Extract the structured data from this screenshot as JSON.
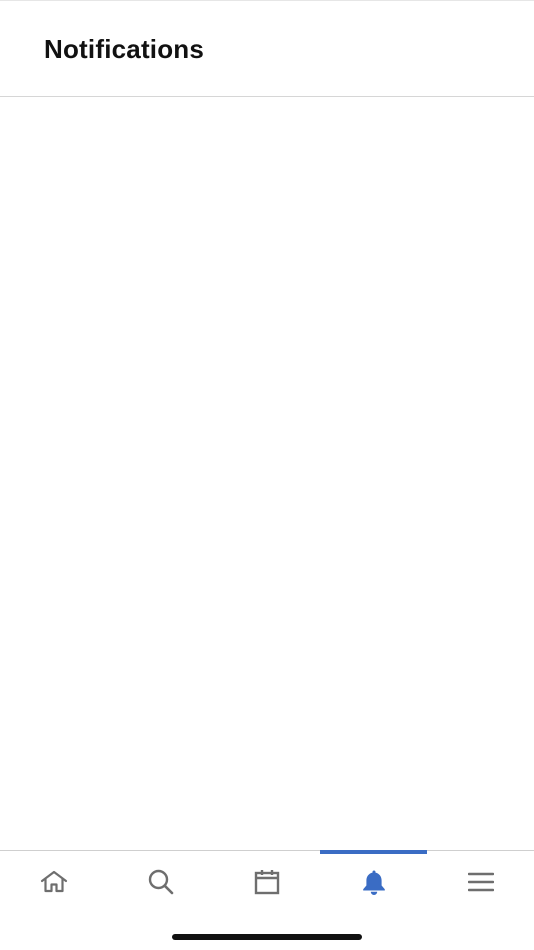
{
  "header": {
    "title": "Notifications"
  },
  "tabbar": {
    "items": [
      {
        "id": "home",
        "icon": "home-icon",
        "active": false
      },
      {
        "id": "search",
        "icon": "search-icon",
        "active": false
      },
      {
        "id": "calendar",
        "icon": "calendar-icon",
        "active": false
      },
      {
        "id": "notifications",
        "icon": "bell-icon",
        "active": true
      },
      {
        "id": "menu",
        "icon": "hamburger-menu-icon",
        "active": false
      }
    ],
    "active_color": "#3a6cc4",
    "inactive_color": "#6e6e6e"
  }
}
